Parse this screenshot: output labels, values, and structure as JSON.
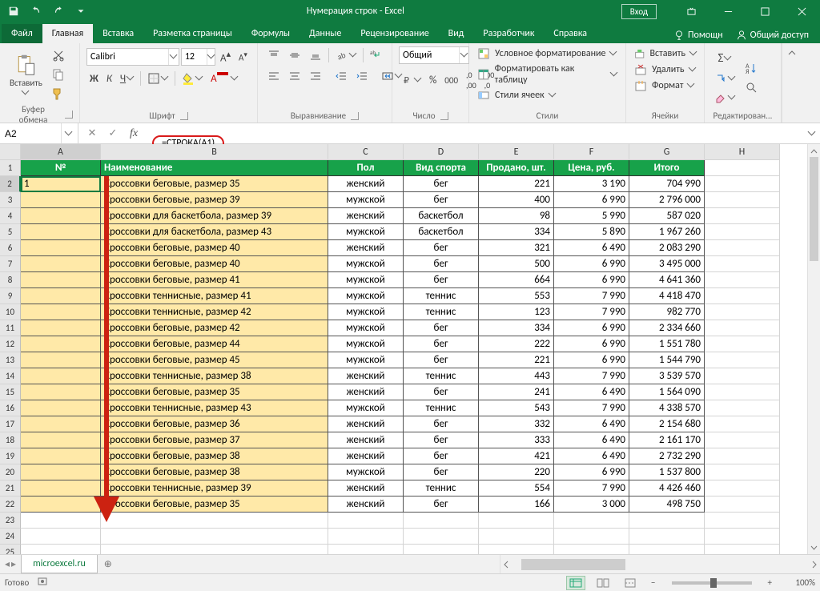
{
  "title": "Нумерация строк  -  Excel",
  "signin": "Вход",
  "tabs": {
    "file": "Файл",
    "home": "Главная",
    "insert": "Вставка",
    "layout": "Разметка страницы",
    "formulas": "Формулы",
    "data": "Данные",
    "review": "Рецензирование",
    "view": "Вид",
    "developer": "Разработчик",
    "help": "Справка"
  },
  "help": {
    "tellme": "Помощн",
    "share": "Общий доступ"
  },
  "ribbon": {
    "paste": "Вставить",
    "clipboard_label": "Буфер обмена",
    "font_name": "Calibri",
    "font_size": "12",
    "font_label": "Шрифт",
    "align_label": "Выравнивание",
    "number_format": "Общий",
    "number_label": "Число",
    "cond_format": "Условное форматирование",
    "format_table": "Форматировать как таблицу",
    "cell_styles": "Стили ячеек",
    "styles_label": "Стили",
    "insert_btn": "Вставить",
    "delete_btn": "Удалить",
    "format_btn": "Формат",
    "cells_label": "Ячейки",
    "editing_label": "Редактирован..."
  },
  "namebox": "A2",
  "formula": "=СТРОКА(A1)",
  "columns": [
    "A",
    "B",
    "C",
    "D",
    "E",
    "F",
    "G",
    "H"
  ],
  "headers": [
    "№",
    "Наименование",
    "Пол",
    "Вид спорта",
    "Продано, шт.",
    "Цена, руб.",
    "Итого"
  ],
  "rows": [
    {
      "n": "1",
      "name": "Кроссовки беговые, размер 35",
      "sex": "женский",
      "sport": "бег",
      "sold": "221",
      "price": "3 190",
      "total": "704 990"
    },
    {
      "n": "",
      "name": "Кроссовки беговые, размер 39",
      "sex": "мужской",
      "sport": "бег",
      "sold": "400",
      "price": "6 990",
      "total": "2 796 000"
    },
    {
      "n": "",
      "name": "Кроссовки для баскетбола, размер 39",
      "sex": "женский",
      "sport": "баскетбол",
      "sold": "98",
      "price": "5 990",
      "total": "587 020"
    },
    {
      "n": "",
      "name": "Кроссовки для баскетбола, размер 43",
      "sex": "мужской",
      "sport": "баскетбол",
      "sold": "334",
      "price": "5 890",
      "total": "1 967 260"
    },
    {
      "n": "",
      "name": "Кроссовки беговые, размер 40",
      "sex": "женский",
      "sport": "бег",
      "sold": "321",
      "price": "6 490",
      "total": "2 083 290"
    },
    {
      "n": "",
      "name": "Кроссовки беговые, размер 40",
      "sex": "мужской",
      "sport": "бег",
      "sold": "500",
      "price": "6 990",
      "total": "3 495 000"
    },
    {
      "n": "",
      "name": "Кроссовки беговые, размер 41",
      "sex": "мужской",
      "sport": "бег",
      "sold": "664",
      "price": "6 990",
      "total": "4 641 360"
    },
    {
      "n": "",
      "name": "Кроссовки теннисные, размер 41",
      "sex": "мужской",
      "sport": "теннис",
      "sold": "553",
      "price": "7 990",
      "total": "4 418 470"
    },
    {
      "n": "",
      "name": "Кроссовки теннисные, размер 42",
      "sex": "мужской",
      "sport": "теннис",
      "sold": "123",
      "price": "7 990",
      "total": "982 770"
    },
    {
      "n": "",
      "name": "Кроссовки беговые, размер 42",
      "sex": "мужской",
      "sport": "бег",
      "sold": "334",
      "price": "6 990",
      "total": "2 334 660"
    },
    {
      "n": "",
      "name": "Кроссовки беговые, размер 44",
      "sex": "мужской",
      "sport": "бег",
      "sold": "222",
      "price": "6 990",
      "total": "1 551 780"
    },
    {
      "n": "",
      "name": "Кроссовки беговые, размер 45",
      "sex": "мужской",
      "sport": "бег",
      "sold": "221",
      "price": "6 990",
      "total": "1 544 790"
    },
    {
      "n": "",
      "name": "Кроссовки теннисные, размер 38",
      "sex": "женский",
      "sport": "теннис",
      "sold": "443",
      "price": "7 990",
      "total": "3 539 570"
    },
    {
      "n": "",
      "name": "Кроссовки беговые, размер 35",
      "sex": "женский",
      "sport": "бег",
      "sold": "241",
      "price": "6 490",
      "total": "1 564 090"
    },
    {
      "n": "",
      "name": "Кроссовки теннисные, размер 43",
      "sex": "мужской",
      "sport": "теннис",
      "sold": "543",
      "price": "7 990",
      "total": "4 338 570"
    },
    {
      "n": "",
      "name": "Кроссовки беговые, размер 36",
      "sex": "женский",
      "sport": "бег",
      "sold": "332",
      "price": "6 490",
      "total": "2 154 680"
    },
    {
      "n": "",
      "name": "Кроссовки беговые, размер 37",
      "sex": "женский",
      "sport": "бег",
      "sold": "333",
      "price": "6 490",
      "total": "2 161 170"
    },
    {
      "n": "",
      "name": "Кроссовки беговые, размер 38",
      "sex": "женский",
      "sport": "бег",
      "sold": "421",
      "price": "6 490",
      "total": "2 732 290"
    },
    {
      "n": "",
      "name": "Кроссовки беговые, размер 38",
      "sex": "мужской",
      "sport": "бег",
      "sold": "220",
      "price": "6 990",
      "total": "1 537 800"
    },
    {
      "n": "",
      "name": "Кроссовки теннисные, размер 39",
      "sex": "женский",
      "sport": "теннис",
      "sold": "554",
      "price": "7 990",
      "total": "4 426 460"
    },
    {
      "n": "",
      "name": "Кроссовки беговые, размер 35",
      "sex": "женский",
      "sport": "бег",
      "sold": "166",
      "price": "3 000",
      "total": "498 750"
    }
  ],
  "sheet_tab": "microexcel.ru",
  "status": {
    "ready": "Готово",
    "zoom": "100%"
  }
}
